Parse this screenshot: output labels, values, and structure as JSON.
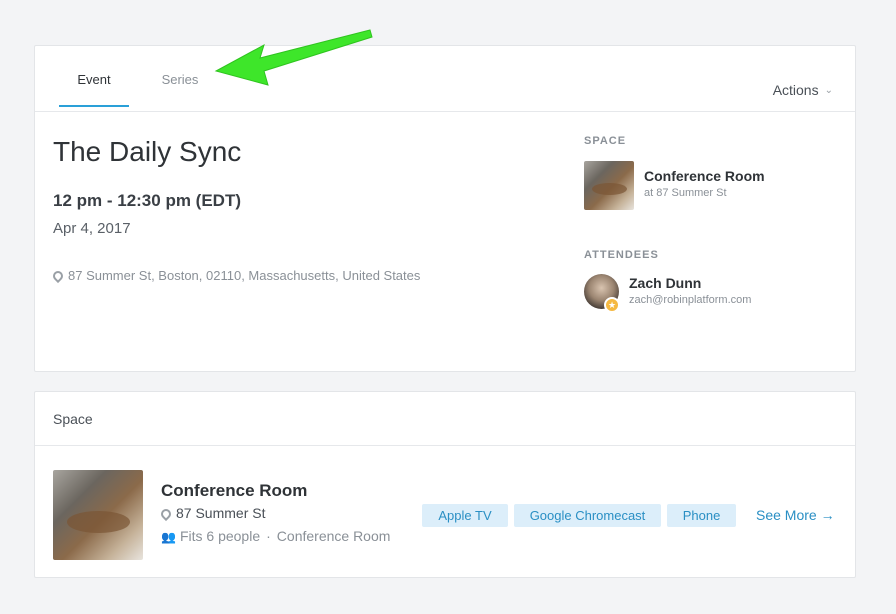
{
  "tabs": [
    {
      "label": "Event"
    },
    {
      "label": "Series"
    }
  ],
  "actions": {
    "label": "Actions"
  },
  "event": {
    "title": "The Daily Sync",
    "time": "12 pm - 12:30 pm (EDT)",
    "date": "Apr 4, 2017",
    "location": "87 Summer St, Boston, 02110, Massachusetts, United States"
  },
  "sidebar": {
    "space_label": "SPACE",
    "space_name": "Conference Room",
    "space_sub": "at 87 Summer St",
    "attendees_label": "ATTENDEES",
    "attendee_name": "Zach Dunn",
    "attendee_email": "zach@robinplatform.com"
  },
  "space_card": {
    "header": "Space",
    "room_name": "Conference Room",
    "address": "87 Summer St",
    "capacity": "Fits 6 people",
    "room_type": "Conference Room",
    "amenities": [
      "Apple TV",
      "Google Chromecast",
      "Phone"
    ],
    "see_more": "See More →"
  },
  "colors": {
    "accent": "#2aa0d8",
    "tag_bg": "#dceefa",
    "tag_text": "#2a8fc4",
    "annotation_arrow": "#3ee62a",
    "badge": "#f5b942"
  }
}
